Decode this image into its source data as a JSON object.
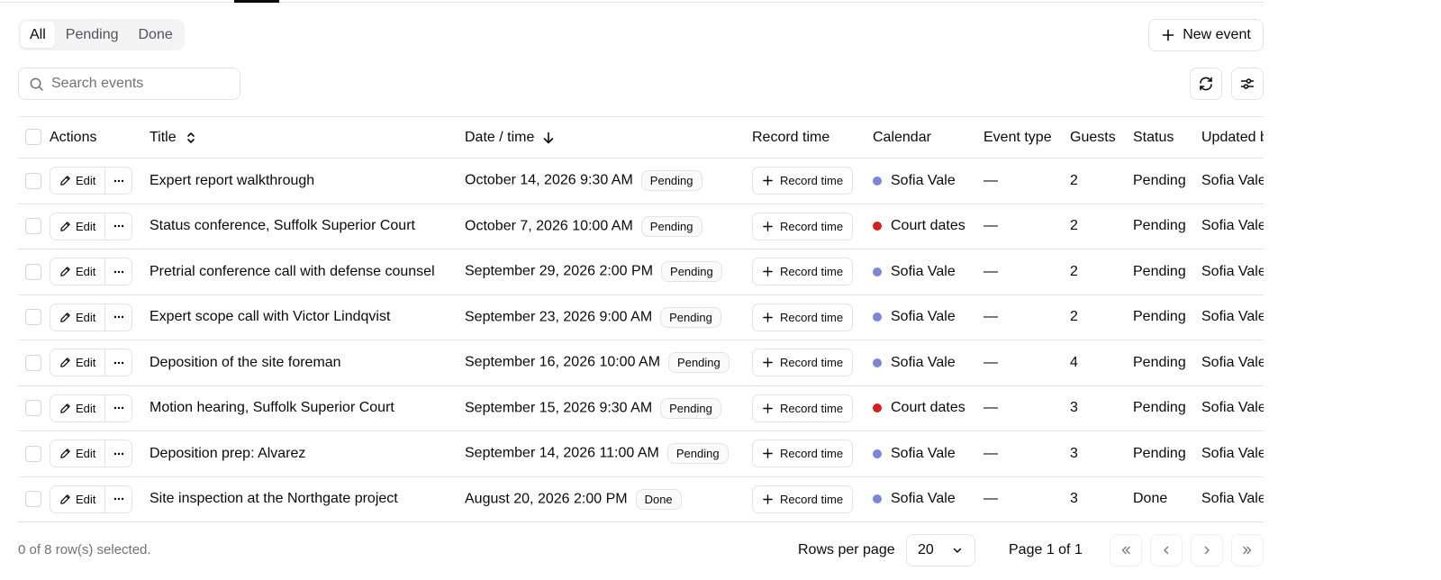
{
  "filters": {
    "tabs": [
      {
        "label": "All",
        "active": true
      },
      {
        "label": "Pending",
        "active": false
      },
      {
        "label": "Done",
        "active": false
      }
    ]
  },
  "toolbar": {
    "new_event_label": "New event",
    "search_placeholder": "Search events",
    "search_value": "",
    "refresh_icon": "refresh-icon",
    "view_options_icon": "sliders-icon"
  },
  "table": {
    "columns": {
      "actions": "Actions",
      "title": "Title",
      "date_time": "Date / time",
      "record_time": "Record time",
      "calendar": "Calendar",
      "event_type": "Event type",
      "guests": "Guests",
      "status": "Status",
      "updated_by": "Updated by"
    },
    "edit_label": "Edit",
    "record_label": "Record time",
    "calendar_colors": {
      "Sofia Vale": "#7b86d6",
      "Court dates": "#d61f1f"
    },
    "rows": [
      {
        "title": "Expert report walkthrough",
        "date": "October 14, 2026 9:30 AM",
        "badge": "Pending",
        "calendar": "Sofia Vale",
        "event_type": "—",
        "guests": "2",
        "status": "Pending",
        "updated_by": "Sofia Vale"
      },
      {
        "title": "Status conference, Suffolk Superior Court",
        "date": "October 7, 2026 10:00 AM",
        "badge": "Pending",
        "calendar": "Court dates",
        "event_type": "—",
        "guests": "2",
        "status": "Pending",
        "updated_by": "Sofia Vale"
      },
      {
        "title": "Pretrial conference call with defense counsel",
        "date": "September 29, 2026 2:00 PM",
        "badge": "Pending",
        "calendar": "Sofia Vale",
        "event_type": "—",
        "guests": "2",
        "status": "Pending",
        "updated_by": "Sofia Vale"
      },
      {
        "title": "Expert scope call with Victor Lindqvist",
        "date": "September 23, 2026 9:00 AM",
        "badge": "Pending",
        "calendar": "Sofia Vale",
        "event_type": "—",
        "guests": "2",
        "status": "Pending",
        "updated_by": "Sofia Vale"
      },
      {
        "title": "Deposition of the site foreman",
        "date": "September 16, 2026 10:00 AM",
        "badge": "Pending",
        "calendar": "Sofia Vale",
        "event_type": "—",
        "guests": "4",
        "status": "Pending",
        "updated_by": "Sofia Vale"
      },
      {
        "title": "Motion hearing, Suffolk Superior Court",
        "date": "September 15, 2026 9:30 AM",
        "badge": "Pending",
        "calendar": "Court dates",
        "event_type": "—",
        "guests": "3",
        "status": "Pending",
        "updated_by": "Sofia Vale"
      },
      {
        "title": "Deposition prep: Alvarez",
        "date": "September 14, 2026 11:00 AM",
        "badge": "Pending",
        "calendar": "Sofia Vale",
        "event_type": "—",
        "guests": "3",
        "status": "Pending",
        "updated_by": "Sofia Vale"
      },
      {
        "title": "Site inspection at the Northgate project",
        "date": "August 20, 2026 2:00 PM",
        "badge": "Done",
        "calendar": "Sofia Vale",
        "event_type": "—",
        "guests": "3",
        "status": "Done",
        "updated_by": "Sofia Vale"
      }
    ]
  },
  "footer": {
    "selected_text": "0 of 8 row(s) selected.",
    "rows_per_page_label": "Rows per page",
    "rows_per_page_value": "20",
    "page_text": "Page 1 of 1"
  }
}
